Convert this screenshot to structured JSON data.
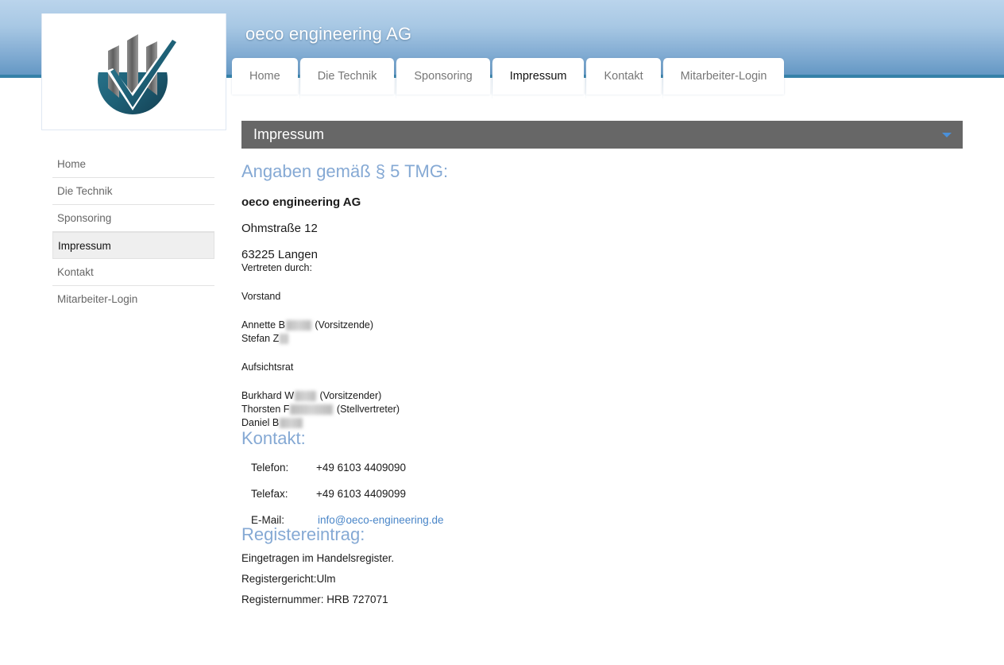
{
  "header": {
    "site_title": "oeco engineering AG",
    "logo_alt": "oeco-logo",
    "colors": {
      "gradient_top": "#bad4ec",
      "gradient_bottom": "#6498c4",
      "underline": "#3581a8",
      "accent_link": "#4a86c8",
      "heading": "#85a9d4",
      "titlebar": "#676767",
      "caret": "#4a90d9"
    }
  },
  "tabs": [
    {
      "label": "Home",
      "active": false
    },
    {
      "label": "Die Technik",
      "active": false
    },
    {
      "label": "Sponsoring",
      "active": false
    },
    {
      "label": "Impressum",
      "active": true
    },
    {
      "label": "Kontakt",
      "active": false
    },
    {
      "label": "Mitarbeiter-Login",
      "active": false
    }
  ],
  "sidebar": {
    "items": [
      {
        "label": "Home",
        "active": false
      },
      {
        "label": "Die Technik",
        "active": false
      },
      {
        "label": "Sponsoring",
        "active": false
      },
      {
        "label": "Impressum",
        "active": true
      },
      {
        "label": "Kontakt",
        "active": false
      },
      {
        "label": "Mitarbeiter-Login",
        "active": false
      }
    ]
  },
  "page": {
    "title": "Impressum",
    "caret_icon": "chevron-down-icon"
  },
  "content": {
    "tmg": {
      "heading": "Angaben gemäß § 5 TMG:",
      "company": "oeco engineering AG",
      "street": "Ohmstraße 12",
      "city": "63225 Langen",
      "represented_by_label": "Vertreten durch:",
      "board_label": "Vorstand",
      "board_members": [
        {
          "prefix": "Annette B",
          "redacted_width": 32,
          "suffix": " (Vorsitzende)"
        },
        {
          "prefix": "Stefan Z",
          "redacted_width": 11,
          "suffix": ""
        }
      ],
      "supervisory_label": "Aufsichtsrat",
      "supervisory_members": [
        {
          "prefix": "Burkhard W",
          "redacted_width": 27,
          "suffix": " (Vorsitzender)"
        },
        {
          "prefix": "Thorsten F",
          "redacted_width": 54,
          "suffix": " (Stellvertreter)"
        },
        {
          "prefix": "Daniel B",
          "redacted_width": 29,
          "suffix": ""
        }
      ]
    },
    "kontakt": {
      "heading": "Kontakt:",
      "rows": [
        {
          "key": "Telefon:",
          "value": "+49 6103 4409090",
          "is_link": false
        },
        {
          "key": "Telefax:",
          "value": "+49 6103 4409099",
          "is_link": false
        },
        {
          "key": "E-Mail:",
          "value": "info@oeco-engineering.de",
          "is_link": true
        }
      ]
    },
    "register": {
      "heading": "Registereintrag:",
      "lines": [
        "Eingetragen im Handelsregister.",
        "Registergericht:Ulm",
        "Registernummer: HRB 727071"
      ]
    }
  }
}
